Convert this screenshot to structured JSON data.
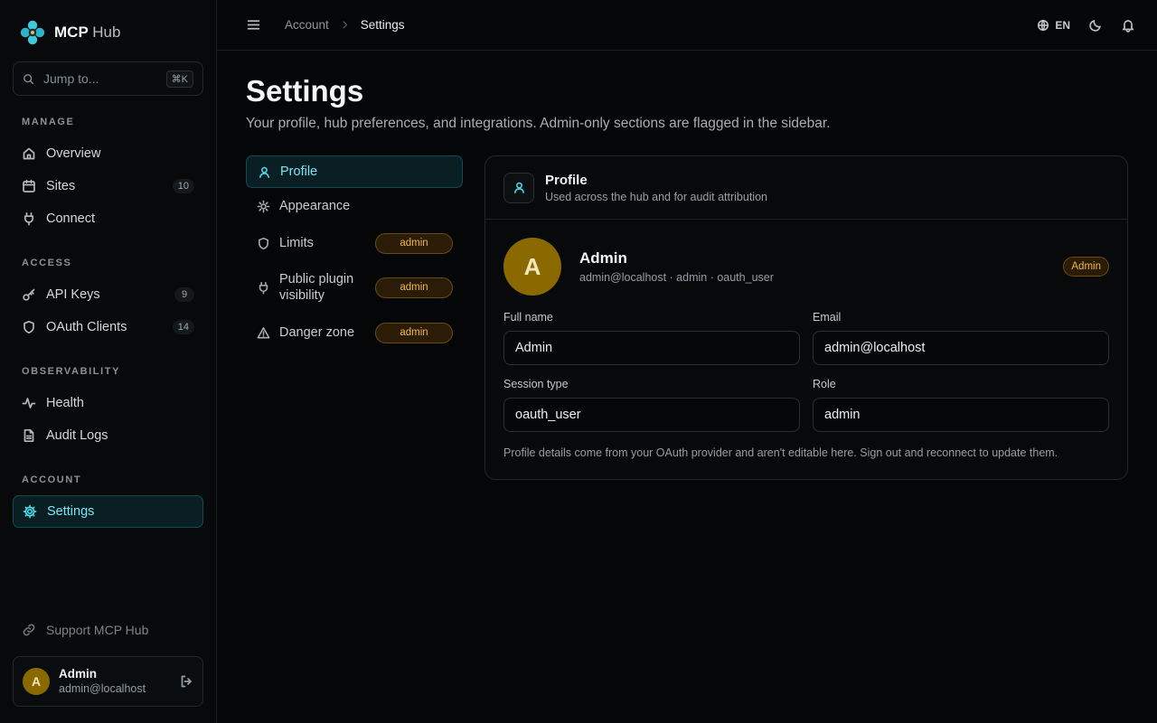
{
  "brand": {
    "name_bold": "MCP",
    "name_light": "Hub"
  },
  "search": {
    "placeholder": "Jump to...",
    "shortcut": "⌘K"
  },
  "sidebar": {
    "sections": {
      "manage": "MANAGE",
      "access": "ACCESS",
      "observability": "OBSERVABILITY",
      "account": "ACCOUNT"
    },
    "items": {
      "overview": {
        "label": "Overview",
        "icon": "home-icon"
      },
      "sites": {
        "label": "Sites",
        "count": "10",
        "icon": "calendar-icon"
      },
      "connect": {
        "label": "Connect",
        "icon": "plug-icon"
      },
      "api_keys": {
        "label": "API Keys",
        "count": "9",
        "icon": "key-icon"
      },
      "oauth_clients": {
        "label": "OAuth Clients",
        "count": "14",
        "icon": "shield-icon"
      },
      "health": {
        "label": "Health",
        "icon": "activity-icon"
      },
      "audit_logs": {
        "label": "Audit Logs",
        "icon": "file-icon"
      },
      "settings": {
        "label": "Settings",
        "icon": "gear-icon",
        "active": true
      }
    },
    "support": "Support MCP Hub",
    "user": {
      "initial": "A",
      "name": "Admin",
      "email": "admin@localhost"
    }
  },
  "topbar": {
    "breadcrumb": [
      "Account",
      "Settings"
    ],
    "language": "EN"
  },
  "page": {
    "title": "Settings",
    "subtitle": "Your profile, hub preferences, and integrations. Admin-only sections are flagged in the sidebar."
  },
  "settings_nav": [
    {
      "label": "Profile",
      "icon": "user-icon",
      "active": true
    },
    {
      "label": "Appearance",
      "icon": "sun-icon"
    },
    {
      "label": "Limits",
      "icon": "shield-icon",
      "badge": "admin"
    },
    {
      "label": "Public plugin visibility",
      "icon": "plug-icon",
      "badge": "admin"
    },
    {
      "label": "Danger zone",
      "icon": "warning-icon",
      "badge": "admin"
    }
  ],
  "profile_card": {
    "title": "Profile",
    "subtitle": "Used across the hub and for audit attribution",
    "initial": "A",
    "name": "Admin",
    "meta_line": "admin@localhost · admin · oauth_user",
    "role_badge": "Admin",
    "fields": {
      "full_name": {
        "label": "Full name",
        "value": "Admin"
      },
      "email": {
        "label": "Email",
        "value": "admin@localhost"
      },
      "session_type": {
        "label": "Session type",
        "value": "oauth_user"
      },
      "role": {
        "label": "Role",
        "value": "admin"
      }
    },
    "note": "Profile details come from your OAuth provider and aren't editable here. Sign out and reconnect to update them."
  },
  "colors": {
    "accent": "#4fd4e4",
    "admin_badge": "#f2b54b",
    "avatar": "#8a6a00",
    "background": "#040607"
  }
}
